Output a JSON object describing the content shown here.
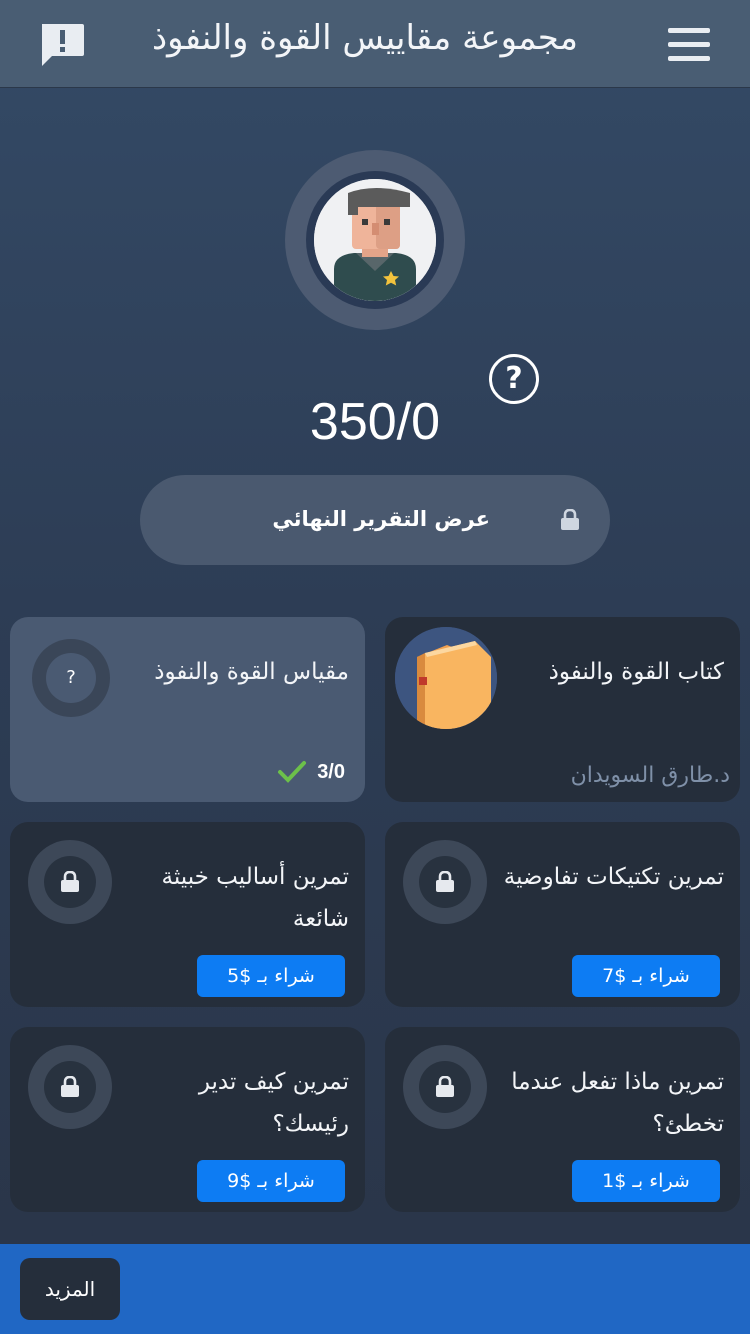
{
  "header": {
    "title": "مجموعة مقاييس القوة  والنفوذ",
    "menu_icon": "menu-icon",
    "feedback_icon": "feedback-icon"
  },
  "profile": {
    "avatar": "user-avatar",
    "score": "350/0",
    "help_symbol": "?"
  },
  "report": {
    "label": "عرض التقرير النهائي",
    "locked": true
  },
  "cards": {
    "book": {
      "title": "كتاب القوة والنفوذ",
      "author": "د.طارق السويدان"
    },
    "scale": {
      "title": "مقياس القوة والنفوذ",
      "icon_symbol": "?",
      "progress": "3/0"
    },
    "negotiation": {
      "title": "تمرين تكتيكات تفاوضية",
      "buy_label": "شراء بـ $7"
    },
    "tactics": {
      "title": "تمرين أساليب خبيثة شائعة",
      "buy_label": "شراء بـ $5"
    },
    "mistake": {
      "title": "تمرين ماذا تفعل عندما تخطئ؟",
      "buy_label": "شراء بـ $1"
    },
    "boss": {
      "title": "تمرين كيف تدير رئيسك؟",
      "buy_label": "شراء بـ $9"
    }
  },
  "footer": {
    "more_label": "المزيد"
  },
  "colors": {
    "accent_blue": "#0d7cf3",
    "footer_blue": "#2067c4",
    "check_green": "#6cc04a"
  }
}
